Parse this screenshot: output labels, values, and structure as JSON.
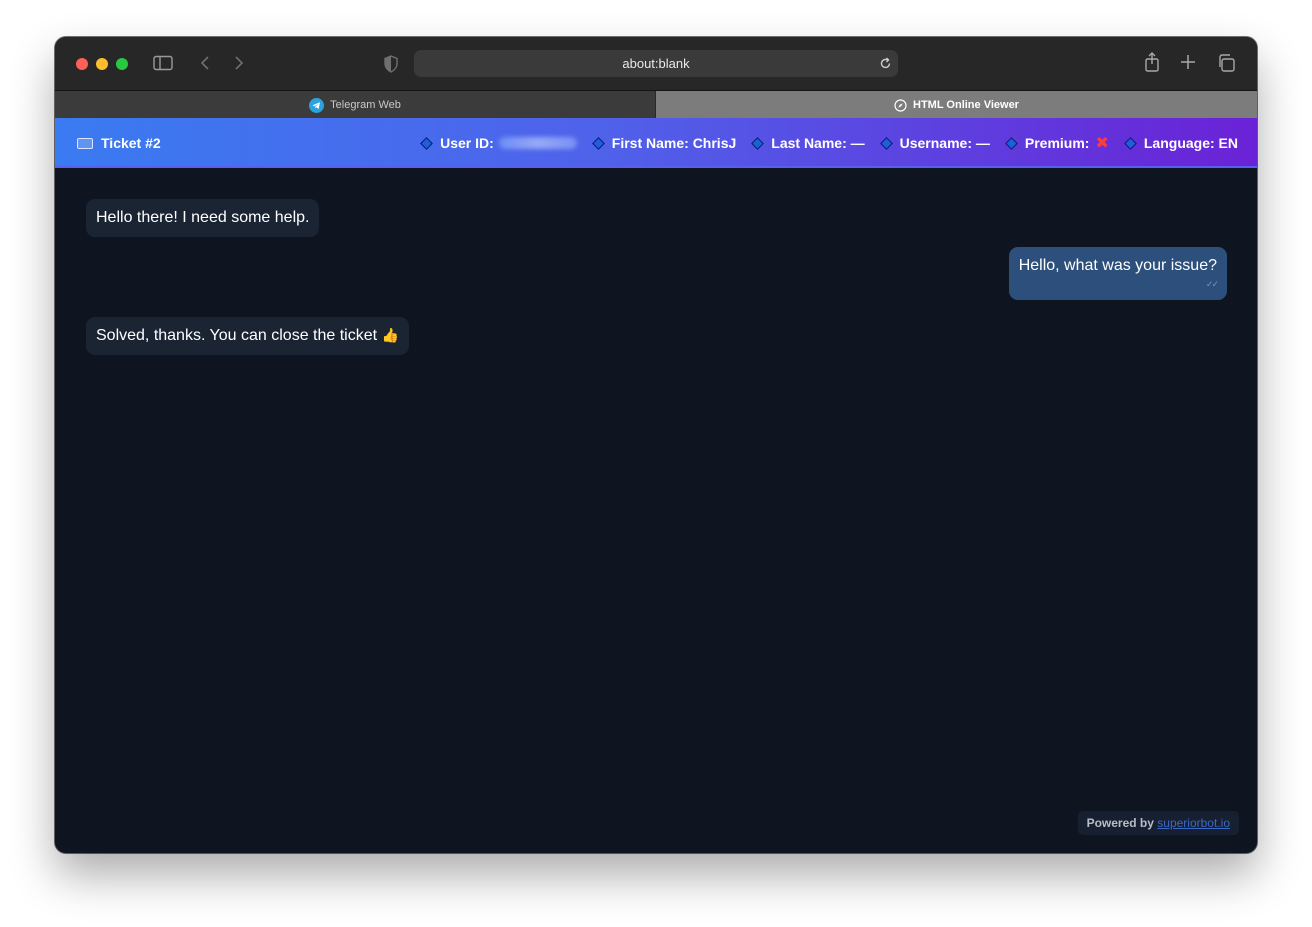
{
  "browser": {
    "address": "about:blank",
    "tabs": [
      {
        "label": "Telegram Web"
      },
      {
        "label": "HTML Online Viewer"
      }
    ]
  },
  "header": {
    "title": "Ticket #2",
    "user_id_label": "User ID:",
    "first_name": "First Name: ChrisJ",
    "last_name": "Last Name: —",
    "username": "Username: —",
    "premium_label": "Premium:",
    "premium_mark": "✖",
    "language": "Language: EN"
  },
  "messages": [
    {
      "text": "Hello there! I need some help.",
      "direction": "incoming"
    },
    {
      "text": "Hello, what was your issue?",
      "direction": "outgoing",
      "status": "✓✓"
    },
    {
      "text": "Solved, thanks. You can close the ticket",
      "emoji": "👍",
      "direction": "incoming"
    }
  ],
  "footer": {
    "powered_label": "Powered by",
    "link_text": "superiorbot.io"
  },
  "colors": {
    "header_start": "#3a7bf1",
    "header_end": "#6a22d6",
    "outgoing_bubble": "#2d4f7c",
    "incoming_bubble": "#1a2433",
    "background": "#0e1521"
  }
}
